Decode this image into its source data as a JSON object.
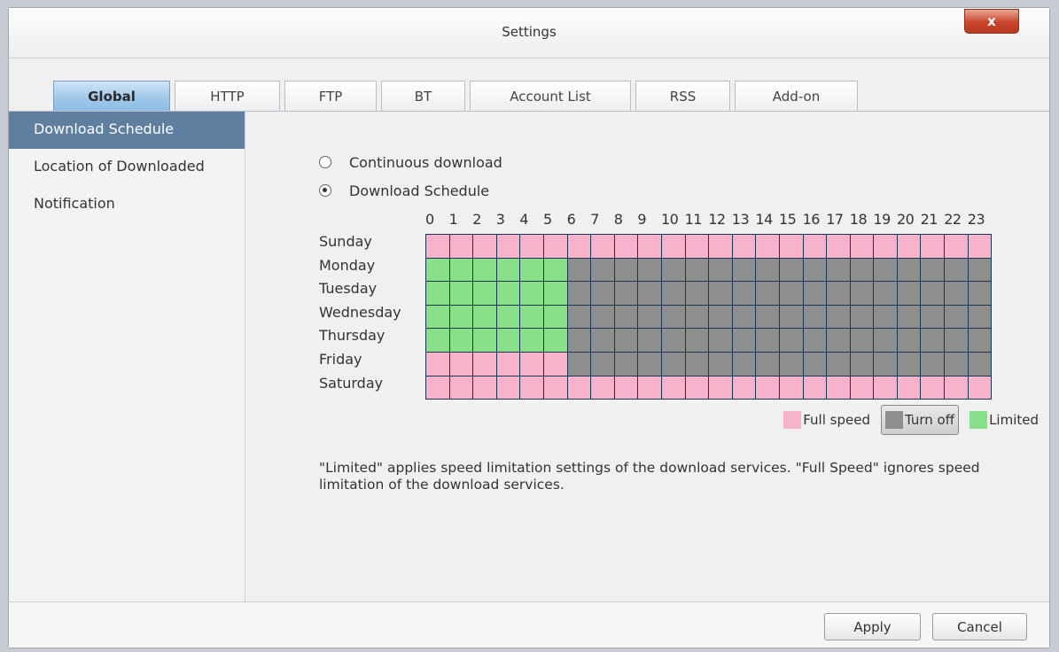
{
  "window": {
    "title": "Settings",
    "close_label": "x"
  },
  "tabs": [
    {
      "label": "Global",
      "active": true
    },
    {
      "label": "HTTP",
      "active": false
    },
    {
      "label": "FTP",
      "active": false
    },
    {
      "label": "BT",
      "active": false
    },
    {
      "label": "Account List",
      "active": false
    },
    {
      "label": "RSS",
      "active": false
    },
    {
      "label": "Add-on",
      "active": false
    }
  ],
  "sidebar": {
    "items": [
      {
        "label": "Download Schedule",
        "active": true
      },
      {
        "label": "Location of Downloaded",
        "active": false
      },
      {
        "label": "Notification",
        "active": false
      }
    ]
  },
  "mode": {
    "options": [
      {
        "label": "Continuous download",
        "checked": false
      },
      {
        "label": "Download Schedule",
        "checked": true
      }
    ]
  },
  "schedule": {
    "hours": [
      "0",
      "1",
      "2",
      "3",
      "4",
      "5",
      "6",
      "7",
      "8",
      "9",
      "10",
      "11",
      "12",
      "13",
      "14",
      "15",
      "16",
      "17",
      "18",
      "19",
      "20",
      "21",
      "22",
      "23"
    ],
    "days": [
      "Sunday",
      "Monday",
      "Tuesday",
      "Wednesday",
      "Thursday",
      "Friday",
      "Saturday"
    ],
    "colors": {
      "F": "#f7b3cc",
      "O": "#8e8e8e",
      "L": "#88e08a"
    },
    "rows": [
      "FFFFFFFFFFFFFFFFFFFFFFFF",
      "LLLLLLOOOOOOOOOOOOOOOOOO",
      "LLLLLLOOOOOOOOOOOOOOOOOO",
      "LLLLLLOOOOOOOOOOOOOOOOOO",
      "LLLLLLOOOOOOOOOOOOOOOOOO",
      "FFFFFFOOOOOOOOOOOOOOOOOO",
      "FFFFFFFFFFFFFFFFFFFFFFFF"
    ]
  },
  "legend": {
    "items": [
      {
        "label": "Full speed",
        "color": "#f7b3cc",
        "selected": false
      },
      {
        "label": "Turn off",
        "color": "#8e8e8e",
        "selected": true
      },
      {
        "label": "Limited",
        "color": "#88e08a",
        "selected": false
      }
    ]
  },
  "note": "\"Limited\" applies speed limitation settings of the download services. \"Full Speed\" ignores speed limitation of the download services.",
  "footer": {
    "apply_label": "Apply",
    "cancel_label": "Cancel"
  }
}
